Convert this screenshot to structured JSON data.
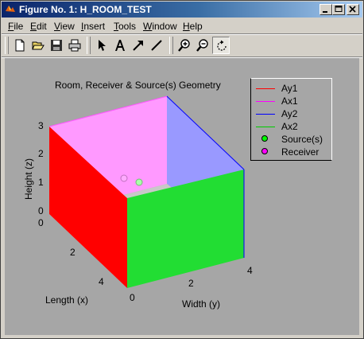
{
  "window": {
    "title": "Figure No. 1: H_ROOM_TEST"
  },
  "menu": {
    "items": [
      "File",
      "Edit",
      "View",
      "Insert",
      "Tools",
      "Window",
      "Help"
    ]
  },
  "toolbar": {
    "buttons": [
      "new-figure-icon",
      "open-file-icon",
      "save-icon",
      "print-icon",
      "edit-plot-arrow-icon",
      "insert-text-icon",
      "insert-arrow-icon",
      "insert-line-icon",
      "zoom-in-icon",
      "zoom-out-icon",
      "rotate-3d-icon"
    ]
  },
  "plot": {
    "title": "Room, Receiver & Source(s) Geometry",
    "xlabel": "Length (x)",
    "ylabel": "Width (y)",
    "zlabel": "Height (z)",
    "x_ticks": [
      "0",
      "2",
      "4"
    ],
    "y_ticks": [
      "0",
      "2",
      "4"
    ],
    "z_ticks": [
      "0",
      "1",
      "2",
      "3"
    ]
  },
  "legend": {
    "entries": [
      {
        "label": "Ay1",
        "color": "#ff0000",
        "kind": "line"
      },
      {
        "label": "Ax1",
        "color": "#ff00ff",
        "kind": "line"
      },
      {
        "label": "Ay2",
        "color": "#0000ff",
        "kind": "line"
      },
      {
        "label": "Ax2",
        "color": "#00cc00",
        "kind": "line"
      },
      {
        "label": "Source(s)",
        "color": "#00ff00",
        "kind": "marker"
      },
      {
        "label": "Receiver",
        "color": "#ff00ff",
        "kind": "marker"
      }
    ]
  },
  "colors": {
    "face_ay1": "#ff0000",
    "face_ax1": "#ff99ff",
    "face_ay2": "#9999ff",
    "face_ax2": "#22dd33",
    "figure_bg": "#a6a6a6"
  }
}
